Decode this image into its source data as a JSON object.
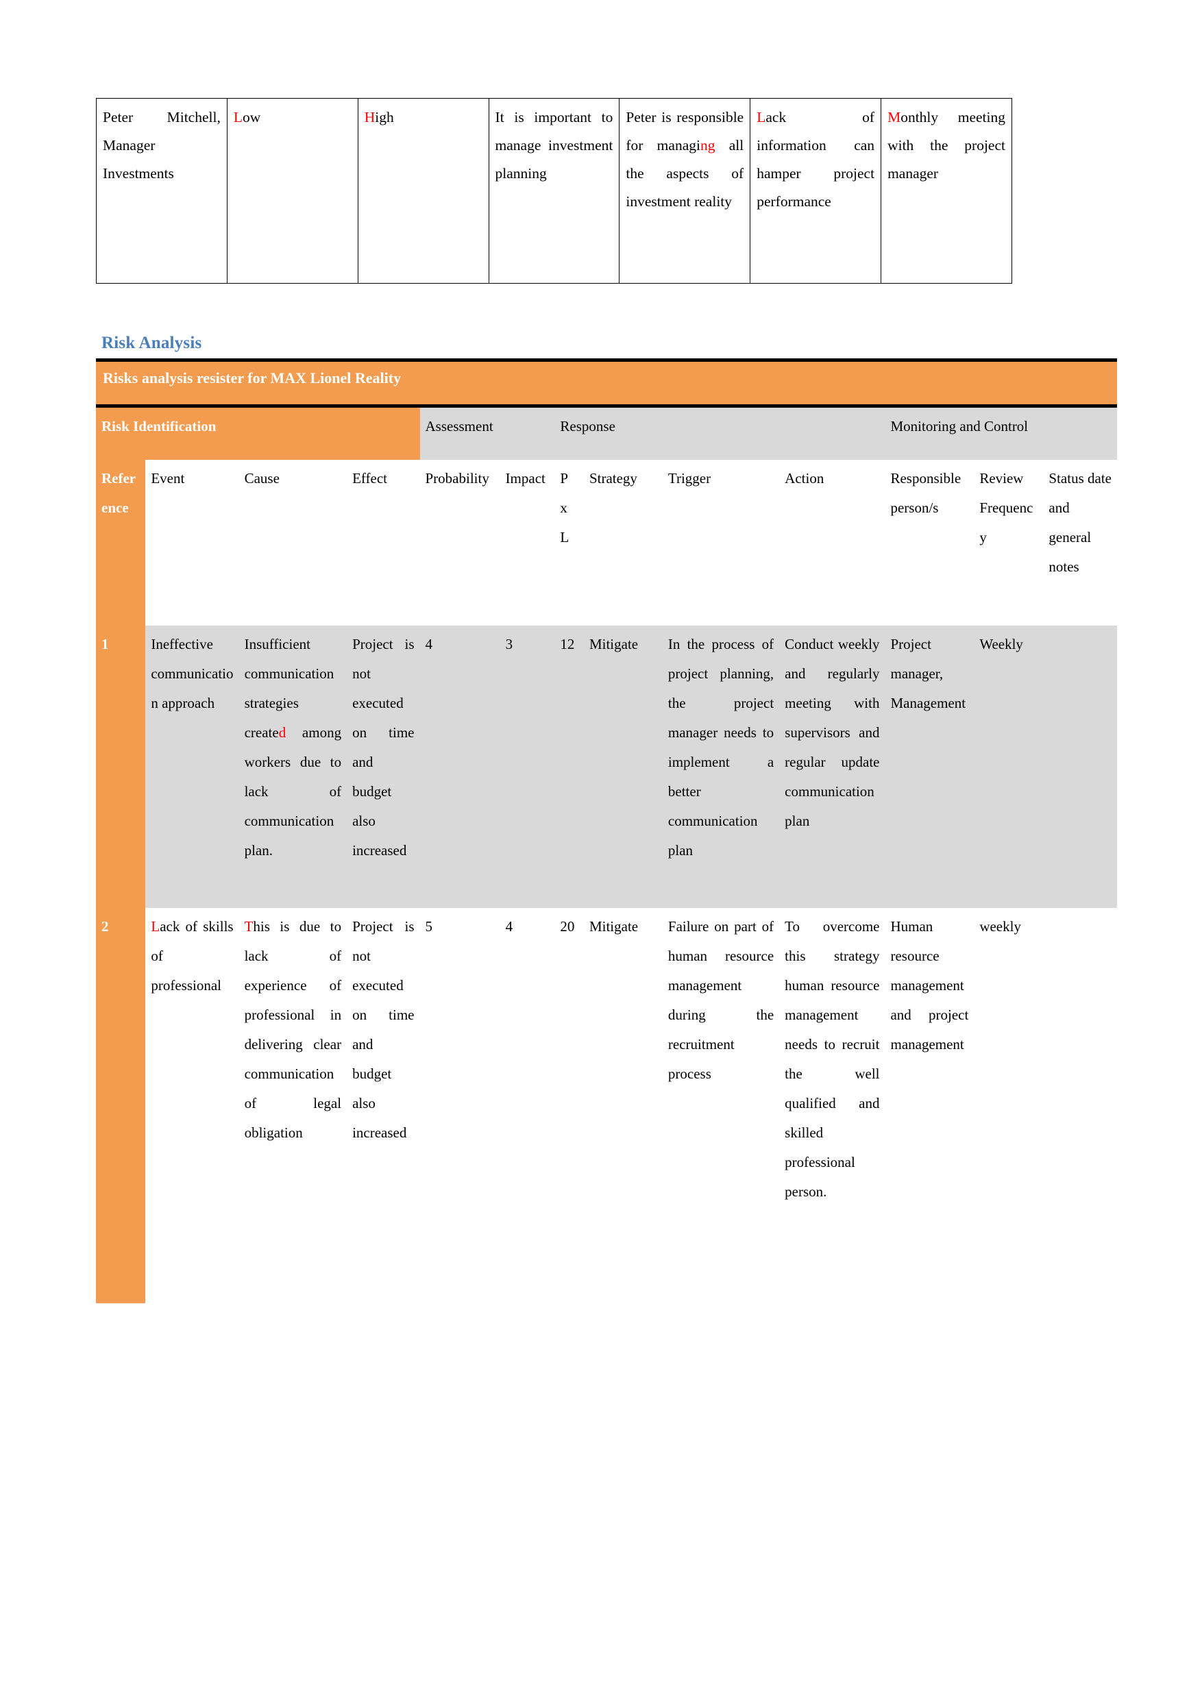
{
  "colors": {
    "orange": "#F39C4F",
    "gray_row": "#D9D9D9",
    "heading_blue": "#4A7EBB",
    "red_accent": "#FF0000",
    "white": "#FFFFFF",
    "black": "#000000"
  },
  "top_table": {
    "rows": [
      {
        "stakeholder": "Peter Mitchell, Manager Investments",
        "column2": "Low",
        "column2_red_prefix": "L",
        "column3": "High",
        "column3_red_prefix": "H",
        "column4": "It is important to manage investment planning",
        "column5_pre": "Peter is responsible for managi",
        "column5_red": "ng",
        "column5_post": " all the aspects of investment reality",
        "column6": "Lack of information can hamper project performance",
        "column6_red_prefix": "L",
        "column7": "Monthly meeting with the project manager",
        "column7_red_prefix": "M"
      }
    ]
  },
  "section": {
    "heading": "Risk Analysis"
  },
  "risk_register": {
    "banner_title": "Risks analysis resister for MAX Lionel Reality",
    "group_headers": {
      "risk_identification": "Risk Identification",
      "assessment": "Assessment",
      "response": "Response",
      "monitoring_and_control": "Monitoring and Control"
    },
    "columns": {
      "reference": "Reference",
      "event": "Event",
      "cause": "Cause",
      "effect": "Effect",
      "probability": "Probability",
      "impact": "Impact",
      "pxl": "P x L",
      "strategy": "Strategy",
      "trigger": "Trigger",
      "action": "Action",
      "responsible_person": "Responsible person/s",
      "review_frequency": "Review Frequency",
      "status_notes": "Status date and general notes"
    },
    "rows": [
      {
        "reference": "1",
        "event": "Ineffective communication approach",
        "cause_pre": "Insufficient communication strategies create",
        "cause_red": "d",
        "cause_post": " among workers due to lack of communication plan.",
        "effect": "Project is not executed on time and budget also increased",
        "probability": "4",
        "impact": "3",
        "pxl": "12",
        "strategy": "Mitigate",
        "trigger": "In the process of project planning, the project manager needs to implement a better communication plan",
        "action": "Conduct weekly and regularly meeting with supervisors and regular update communication plan",
        "responsible_person": "Project manager, Management",
        "review_frequency": "Weekly",
        "status_notes": ""
      },
      {
        "reference": "2",
        "event_red_prefix": "L",
        "event": "Lack of skills of professional",
        "cause_red_prefix": "T",
        "cause": "This is due to lack of experience of professional in delivering clear communication of legal obligation",
        "effect": "Project is not executed on time and budget also increased",
        "probability": "5",
        "impact": "4",
        "pxl": "20",
        "strategy": "Mitigate",
        "trigger": "Failure on part of human resource management during the recruitment process",
        "action": "To overcome this strategy human resource management needs to recruit the well qualified and skilled professional person.",
        "responsible_person": "Human resource management and project management",
        "review_frequency": "weekly",
        "status_notes": ""
      }
    ]
  }
}
